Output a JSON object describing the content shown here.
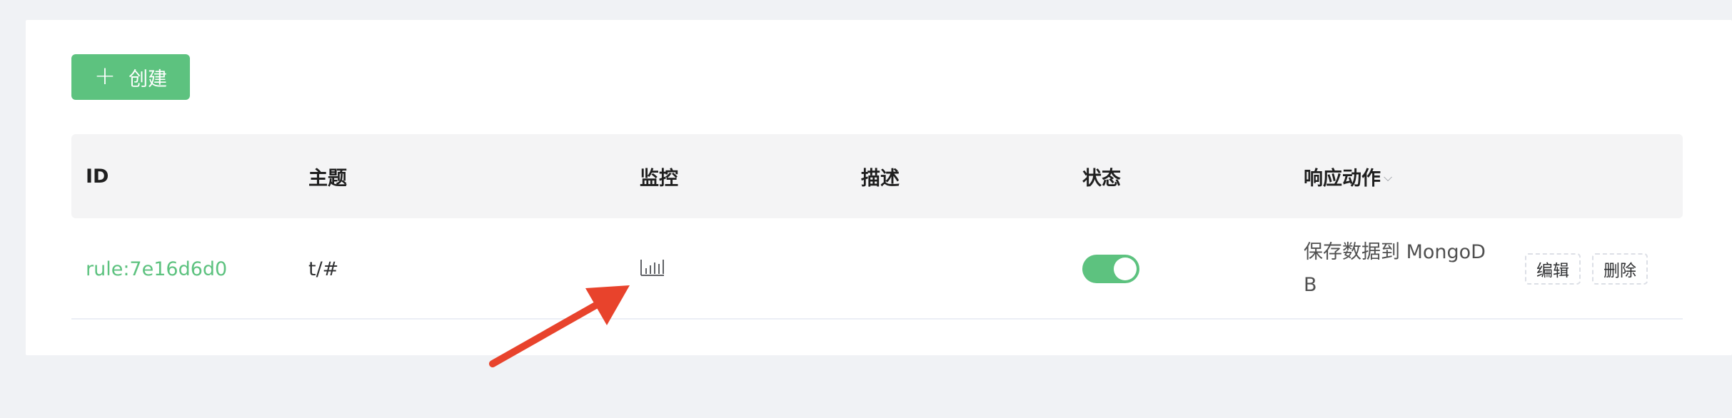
{
  "toolbar": {
    "create_label": "创建",
    "plus_icon": "+"
  },
  "table": {
    "headers": [
      "ID",
      "主题",
      "监控",
      "描述",
      "状态",
      "响应动作"
    ],
    "rows": [
      {
        "id": "rule:7e16d6d0",
        "topic": "t/#",
        "monitor_icon": "bar-chart-icon",
        "description": "",
        "status_enabled": true,
        "action": "保存数据到 MongoDB",
        "edit_label": "编辑",
        "delete_label": "删除"
      }
    ]
  },
  "colors": {
    "accent": "#5dc27f",
    "annotation_arrow": "#e8432c",
    "page_bg": "#f0f2f5"
  }
}
